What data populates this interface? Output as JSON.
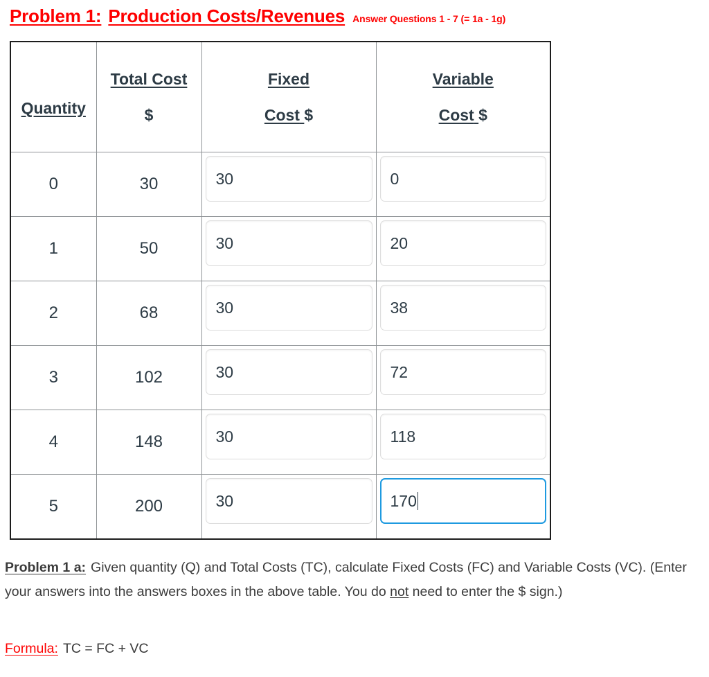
{
  "title": {
    "problem_label": "Problem 1:",
    "problem_name": "Production Costs/Revenues",
    "answer_note": "Answer Questions 1 - 7 (= 1a - 1g)",
    "color": "#fe0000"
  },
  "table": {
    "headers": {
      "quantity": "Quantity",
      "total_cost_line1": "Total Cost",
      "total_cost_line2": "$",
      "fixed_line1": "Fixed",
      "fixed_line2_underlined": "Cost",
      "fixed_line2_dollar": "$",
      "variable_line1": "Variable",
      "variable_line2_underlined": "Cost",
      "variable_line2_dollar": "$"
    },
    "rows": [
      {
        "quantity": "0",
        "total_cost": "30",
        "fixed_cost": "30",
        "variable_cost": "0",
        "focused": false
      },
      {
        "quantity": "1",
        "total_cost": "50",
        "fixed_cost": "30",
        "variable_cost": "20",
        "focused": false
      },
      {
        "quantity": "2",
        "total_cost": "68",
        "fixed_cost": "30",
        "variable_cost": "38",
        "focused": false
      },
      {
        "quantity": "3",
        "total_cost": "102",
        "fixed_cost": "30",
        "variable_cost": "72",
        "focused": false
      },
      {
        "quantity": "4",
        "total_cost": "148",
        "fixed_cost": "30",
        "variable_cost": "118",
        "focused": false
      },
      {
        "quantity": "5",
        "total_cost": "200",
        "fixed_cost": "30",
        "variable_cost": "170",
        "focused": true
      }
    ],
    "focus_border_color": "#1e9ae0",
    "box_border_color": "#dddddd",
    "grid_color": "#8f9396",
    "outer_border_color": "#1c1c1c"
  },
  "body": {
    "problem_1a_label": "Problem 1 a:",
    "problem_1a_text_part1": "Given quantity (Q) and Total Costs (TC), calculate Fixed Costs (FC) and Variable Costs (VC).  (Enter your answers into the answers boxes in the above table. You do ",
    "problem_1a_not": "not",
    "problem_1a_text_part2": " need to enter the $ sign.)",
    "formula_label": "Formula:",
    "formula_text": "TC = FC + VC"
  }
}
